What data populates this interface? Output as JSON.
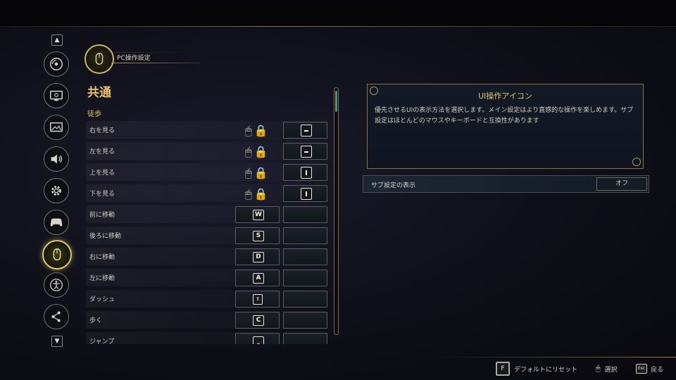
{
  "header": {
    "title": "PC操作設定"
  },
  "section": {
    "title": "共通",
    "subtitle": "徒歩"
  },
  "rows": [
    {
      "label": "右を見る"
    },
    {
      "label": "左を見る"
    },
    {
      "label": "上を見る"
    },
    {
      "label": "下を見る"
    },
    {
      "label": "前に移動",
      "key": "W"
    },
    {
      "label": "後ろに移動",
      "key": "S"
    },
    {
      "label": "右に移動",
      "key": "D"
    },
    {
      "label": "左に移動",
      "key": "A"
    },
    {
      "label": "ダッシュ"
    },
    {
      "label": "歩く",
      "key": "C"
    },
    {
      "label": "ジャンプ"
    }
  ],
  "info": {
    "title": "UI操作アイコン",
    "body": "優先させるUIの表示方法を選択します。メイン設定はより直感的な操作を楽しめます。サブ設定はほとんどのマウスやキーボードと互換性があります"
  },
  "option": {
    "label": "サブ設定の表示",
    "value": "オフ"
  },
  "footer": {
    "reset_key": "F",
    "reset_label": "デフォルトにリセット",
    "select_label": "選択",
    "back_key": "Esc",
    "back_label": "戻る"
  },
  "colors": {
    "accent": "#e8c46a",
    "active_nav": "#d9c86a",
    "scroll": "#4f8f8a"
  }
}
